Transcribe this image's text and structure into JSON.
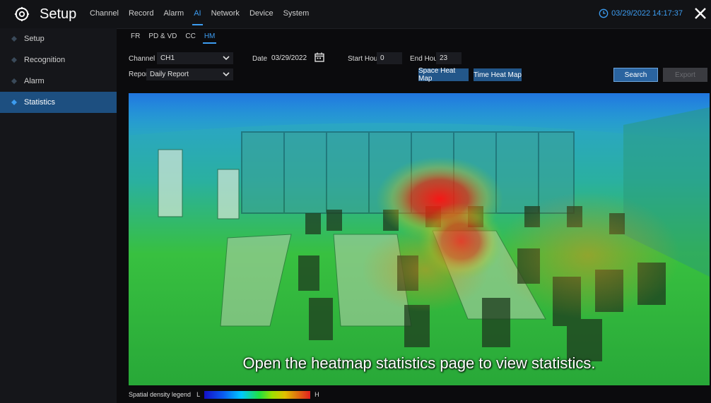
{
  "header": {
    "title": "Setup",
    "menu": [
      "Channel",
      "Record",
      "Alarm",
      "AI",
      "Network",
      "Device",
      "System"
    ],
    "active_menu": "AI",
    "datetime": "03/29/2022 14:17:37"
  },
  "sidebar": {
    "items": [
      {
        "label": "Setup",
        "active": false
      },
      {
        "label": "Recognition",
        "active": false
      },
      {
        "label": "Alarm",
        "active": false
      },
      {
        "label": "Statistics",
        "active": true
      }
    ]
  },
  "subtabs": {
    "items": [
      "FR",
      "PD & VD",
      "CC",
      "HM"
    ],
    "active": "HM"
  },
  "form": {
    "channel_label": "Channel",
    "channel_value": "CH1",
    "date_label": "Date",
    "date_value": "03/29/2022",
    "start_hour_label": "Start Hour",
    "start_hour_value": "0",
    "end_hour_label": "End Hour",
    "end_hour_value": "23",
    "report_type_label": "Report Type",
    "report_type_value": "Daily Report"
  },
  "buttons": {
    "space_heat_map": "Space Heat Map",
    "time_heat_map": "Time Heat Map",
    "search": "Search",
    "export": "Export"
  },
  "heatmap": {
    "caption": "Open the heatmap statistics page to view statistics."
  },
  "legend": {
    "label": "Spatial density legend",
    "low": "L",
    "high": "H"
  },
  "colors": {
    "accent": "#3c9cf0",
    "sidebar_active": "#1d4f80",
    "button": "#23578a"
  }
}
